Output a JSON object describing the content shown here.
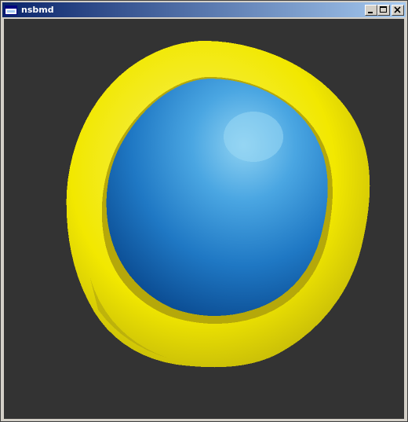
{
  "window": {
    "title": "nsbmd",
    "icons": {
      "app": "app-window-icon",
      "minimize": "minimize-icon",
      "maximize": "maximize-icon",
      "close": "close-icon"
    }
  },
  "viewport": {
    "background_color": "#333333",
    "model": {
      "ring_color": "#f2e800",
      "ring_shadow_color": "#a89c10",
      "sphere_highlight_color": "#8fd2f2",
      "sphere_base_color": "#1f78c4",
      "sphere_shadow_color": "#0a4a90"
    }
  }
}
